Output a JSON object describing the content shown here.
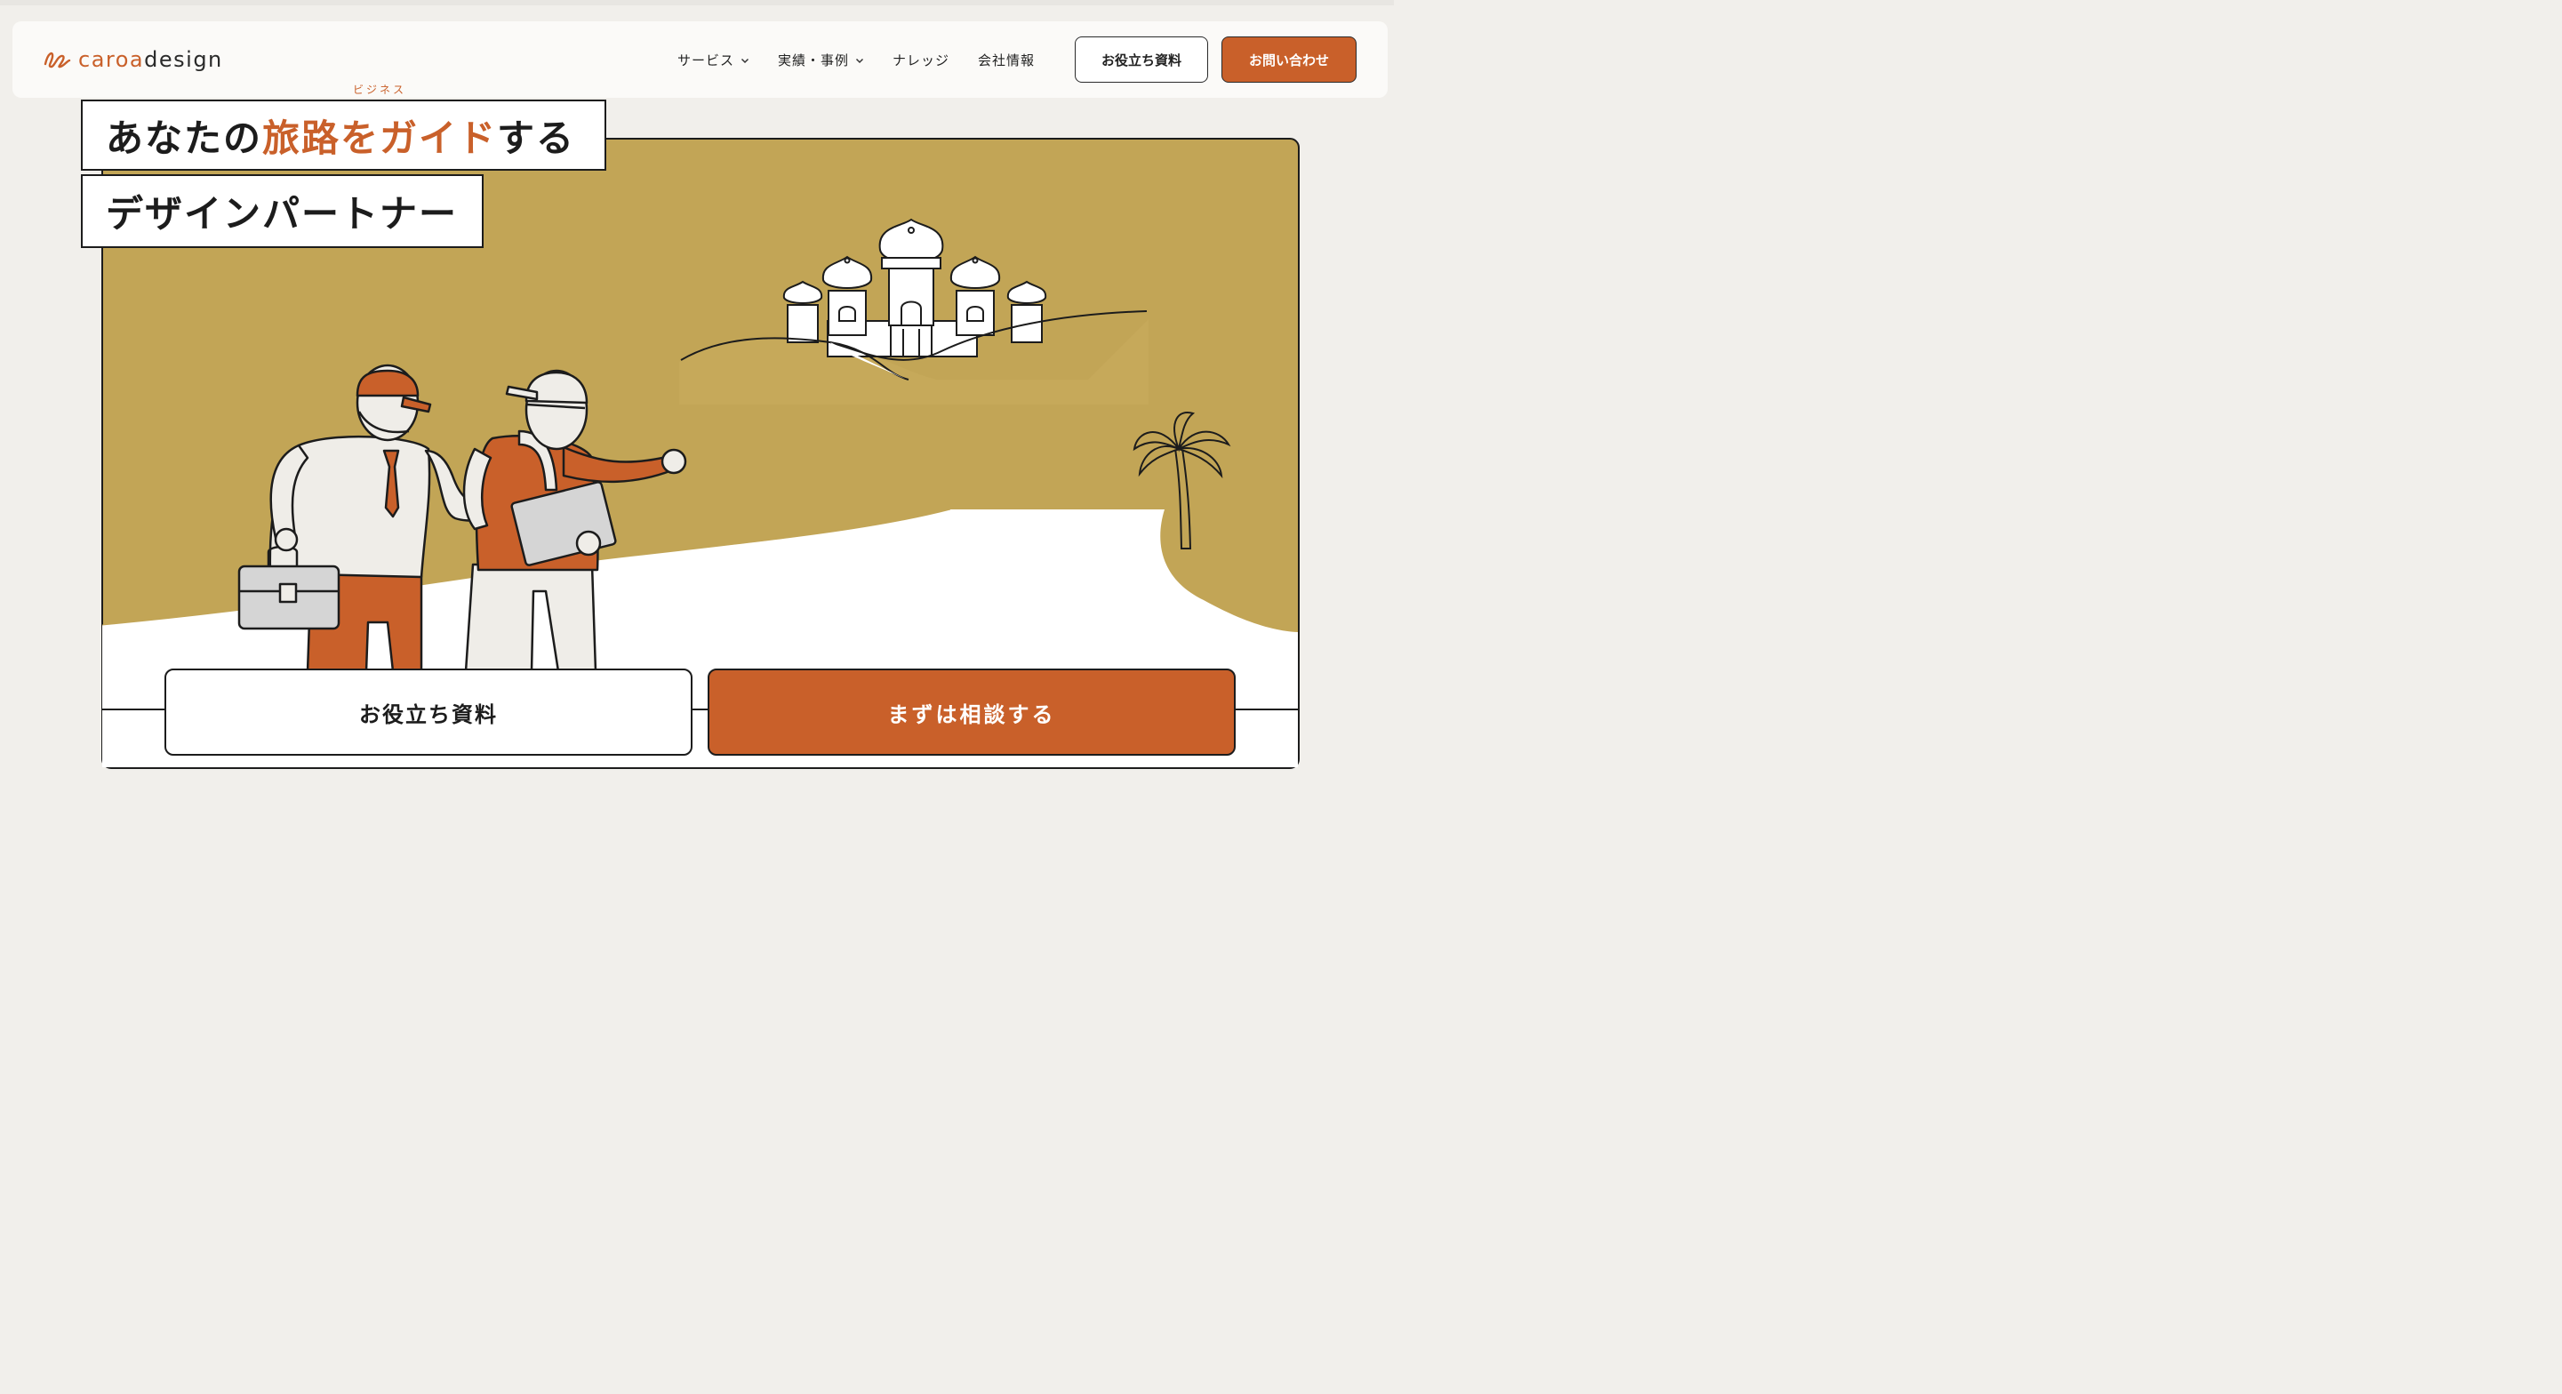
{
  "header": {
    "logo": {
      "accent": "caroa",
      "rest": "design"
    },
    "nav": [
      {
        "label": "サービス",
        "has_dropdown": true
      },
      {
        "label": "実績・事例",
        "has_dropdown": true
      },
      {
        "label": "ナレッジ",
        "has_dropdown": false
      },
      {
        "label": "会社情報",
        "has_dropdown": false
      }
    ],
    "resources_button": "お役立ち資料",
    "contact_button": "お問い合わせ"
  },
  "hero": {
    "line1_before": "あなたの",
    "line1_accent": "旅路をガイド",
    "line1_ruby": "ビジネス",
    "line1_after": "する",
    "line2": "デザインパートナー"
  },
  "cta": {
    "left": "お役立ち資料",
    "right": "まずは相談する"
  },
  "colors": {
    "accent": "#c9602a",
    "sand": "#c2a556",
    "background": "#f1efeb",
    "figure_light": "#efede8",
    "gray": "#d5d5d5"
  },
  "icons": [
    "caroa-logo-icon",
    "chevron-down-icon"
  ]
}
